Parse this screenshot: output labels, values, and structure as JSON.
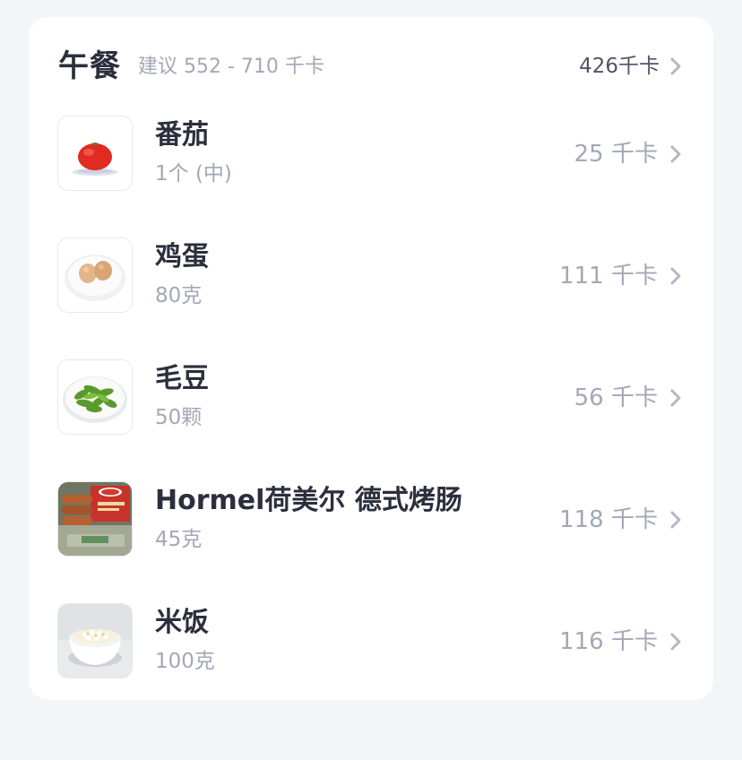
{
  "meal": {
    "title": "午餐",
    "suggestion": "建议 552 - 710 千卡",
    "total_kcal": "426千卡",
    "items": [
      {
        "name": "番茄",
        "amount": "1个 (中)",
        "kcal": "25 千卡",
        "image": "tomato"
      },
      {
        "name": "鸡蛋",
        "amount": "80克",
        "kcal": "111 千卡",
        "image": "eggs"
      },
      {
        "name": "毛豆",
        "amount": "50颗",
        "kcal": "56 千卡",
        "image": "edamame"
      },
      {
        "name": "Hormel荷美尔 德式烤肠",
        "amount": "45克",
        "kcal": "118 千卡",
        "image": "sausage-package"
      },
      {
        "name": "米饭",
        "amount": "100克",
        "kcal": "116 千卡",
        "image": "rice-bowl"
      }
    ]
  },
  "colors": {
    "background": "#f4f5f9",
    "card": "#ffffff",
    "title_text": "#2b2f3d",
    "secondary_text": "#a3a8b6",
    "chevron": "#b4b8c4"
  },
  "icons": {
    "chevron": "chevron-right-icon"
  }
}
